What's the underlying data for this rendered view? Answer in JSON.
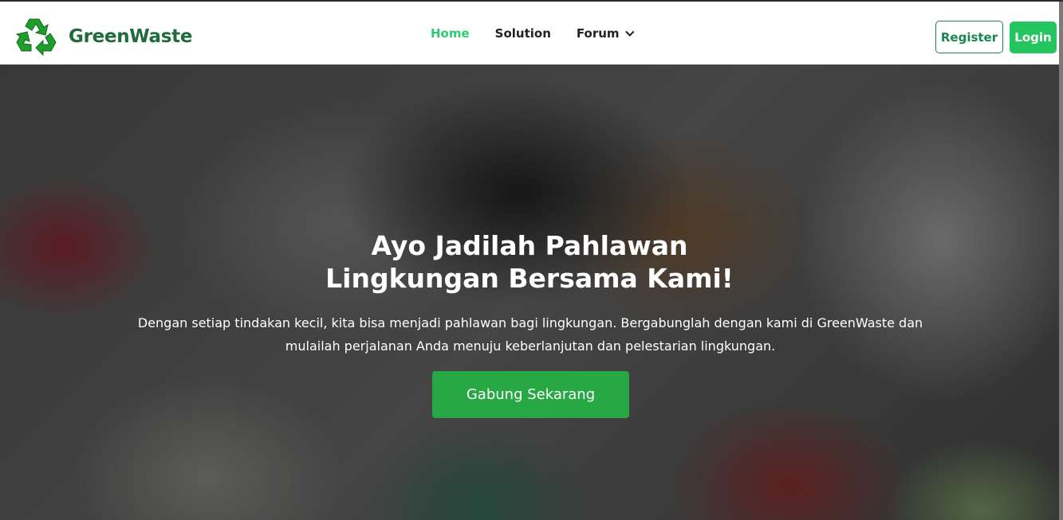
{
  "brand": {
    "name": "GreenWaste",
    "logo_icon": "recycle-icon",
    "color": "#1f6b3c"
  },
  "nav": {
    "items": [
      {
        "label": "Home",
        "active": true
      },
      {
        "label": "Solution"
      },
      {
        "label": "Forum",
        "dropdown": true
      }
    ],
    "active_color": "#2ecc71"
  },
  "auth": {
    "register": "Register",
    "login": "Login",
    "accent": "#22c55e"
  },
  "hero": {
    "title_line1": "Ayo Jadilah Pahlawan",
    "title_line2": "Lingkungan Bersama Kami!",
    "description": "Dengan setiap tindakan kecil, kita bisa menjadi pahlawan bagi lingkungan. Bergabunglah dengan kami di GreenWaste dan mulailah perjalanan Anda menuju keberlanjutan dan pelestarian lingkungan.",
    "cta": "Gabung Sekarang",
    "cta_color": "#28a745"
  }
}
